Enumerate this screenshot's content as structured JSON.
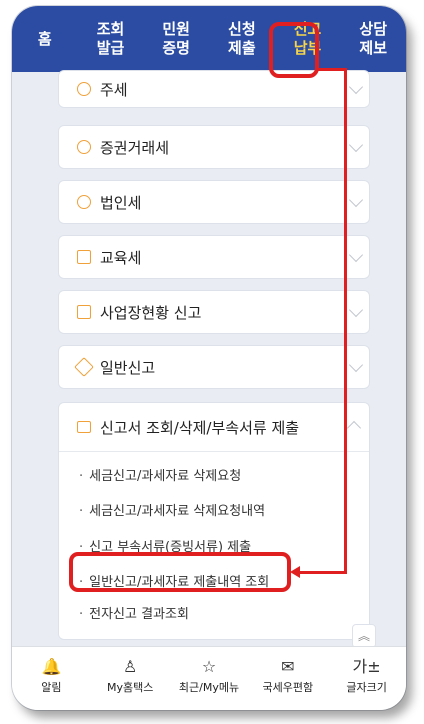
{
  "top_nav": [
    {
      "label": "홈"
    },
    {
      "label": "조회\n발급"
    },
    {
      "label": "민원\n증명"
    },
    {
      "label": "신청\n제출"
    },
    {
      "label": "신고\n납부",
      "active": true
    },
    {
      "label": "상담\n제보"
    }
  ],
  "menu": [
    {
      "label": "주세",
      "icon": "person-icon"
    },
    {
      "label": "증권거래세",
      "icon": "hand-coin-icon"
    },
    {
      "label": "법인세",
      "icon": "medal-icon"
    },
    {
      "label": "교육세",
      "icon": "edit-icon"
    },
    {
      "label": "사업장현황 신고",
      "icon": "memo-icon"
    },
    {
      "label": "일반신고",
      "icon": "tag-icon"
    }
  ],
  "expanded": {
    "label": "신고서 조회/삭제/부속서류 제출",
    "icon": "folder-icon",
    "items": [
      {
        "label": "세금신고/과세자료 삭제요청"
      },
      {
        "label": "세금신고/과세자료 삭제요청내역"
      },
      {
        "label": "신고 부속서류(증빙서류) 제출"
      },
      {
        "label": "일반신고/과세자료 제출내역 조회"
      },
      {
        "label": "전자신고 결과조회"
      }
    ]
  },
  "scroll_top": "︽",
  "bottom_tabs": [
    {
      "label": "알림",
      "icon": "bell-icon",
      "glyph": "🔔"
    },
    {
      "label": "My홈택스",
      "icon": "person-icon",
      "glyph": "♙"
    },
    {
      "label": "최근/My메뉴",
      "icon": "star-icon",
      "glyph": "☆"
    },
    {
      "label": "국세우편함",
      "icon": "mail-icon",
      "glyph": "✉"
    },
    {
      "label": "글자크기",
      "icon": "font-size-icon",
      "glyph": "가±"
    }
  ],
  "colors": {
    "nav_bg": "#2c4ca3",
    "active": "#f7d54a",
    "highlight": "#e02020"
  }
}
